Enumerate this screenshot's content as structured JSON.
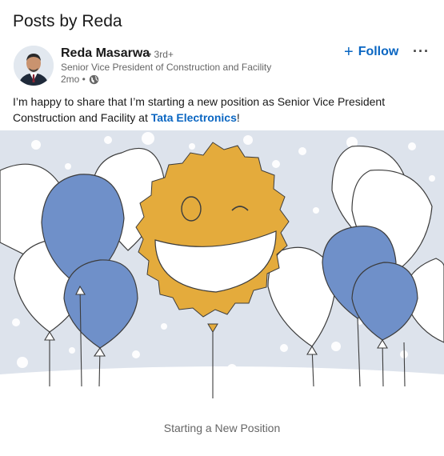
{
  "section": {
    "title": "Posts by Reda"
  },
  "post": {
    "author": {
      "name": "Reda Masarwa",
      "degree": "• 3rd+",
      "headline": "Senior Vice President of Construction and Facility",
      "time": "2mo •",
      "visibility_icon": "globe-icon"
    },
    "follow_label": "Follow",
    "more_icon": "ellipsis-icon",
    "text_before": "I’m happy to share that I’m starting a new position as Senior Vice President Construction and Facility at ",
    "mention": "Tata Electronics",
    "text_after": "!",
    "media": {
      "illustration": "celebration-balloons-smiley",
      "caption": "Starting a New Position"
    }
  },
  "colors": {
    "accent": "#0a66c2",
    "balloon_blue": "#6f90c9",
    "smiley_gold": "#e4ab3c",
    "background_gray": "#dde3ec"
  }
}
